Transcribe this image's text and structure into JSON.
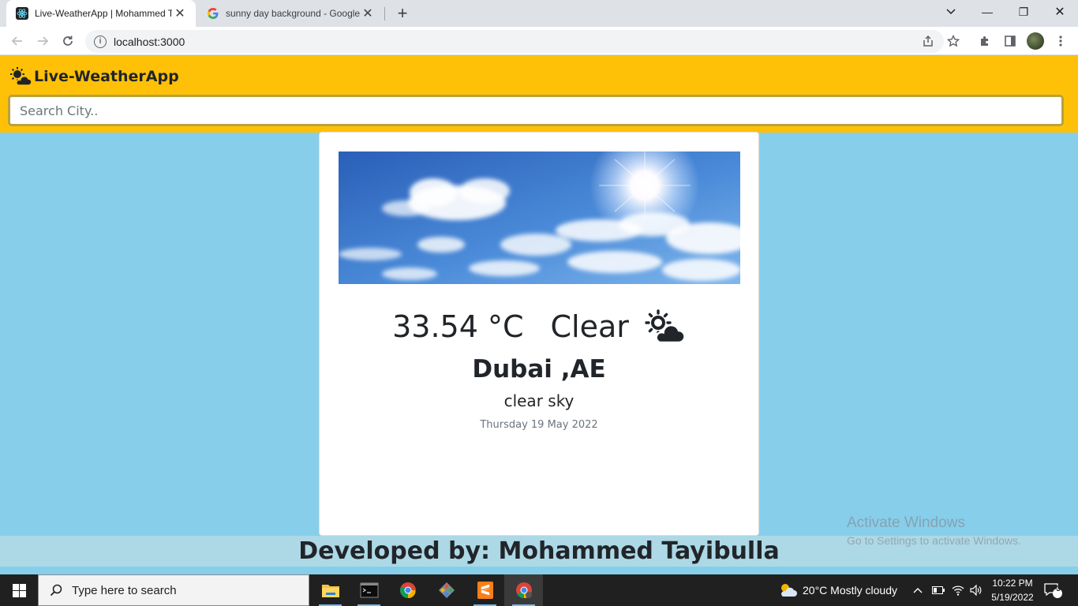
{
  "browser": {
    "tabs": [
      {
        "title": "Live-WeatherApp | Mohammed T",
        "close": "✕"
      },
      {
        "title": "sunny day background - Google",
        "close": "✕"
      }
    ],
    "new_tab": "+",
    "url": "localhost:3000",
    "window_controls": {
      "minimize": "—",
      "restore": "❐",
      "close": "✕"
    }
  },
  "app": {
    "brand": "Live-WeatherApp",
    "search_placeholder": "Search City.."
  },
  "weather": {
    "temperature": "33.54 °C",
    "condition": "Clear",
    "city": "Dubai ,AE",
    "description": "clear sky",
    "date": "Thursday 19 May 2022",
    "icon": "sun-cloud-icon"
  },
  "footer": {
    "credit": "Developed by: Mohammed Tayibulla"
  },
  "watermark": {
    "title": "Activate Windows",
    "subtitle": "Go to Settings to activate Windows."
  },
  "taskbar": {
    "search_placeholder": "Type here to search",
    "weather": "20°C  Mostly cloudy",
    "time": "10:22 PM",
    "date": "5/19/2022",
    "notifications": "3"
  },
  "colors": {
    "appbar": "#ffc107",
    "page_bg": "#87ceeb",
    "footer_bg": "#add8e6",
    "card_bg": "#ffffff"
  }
}
